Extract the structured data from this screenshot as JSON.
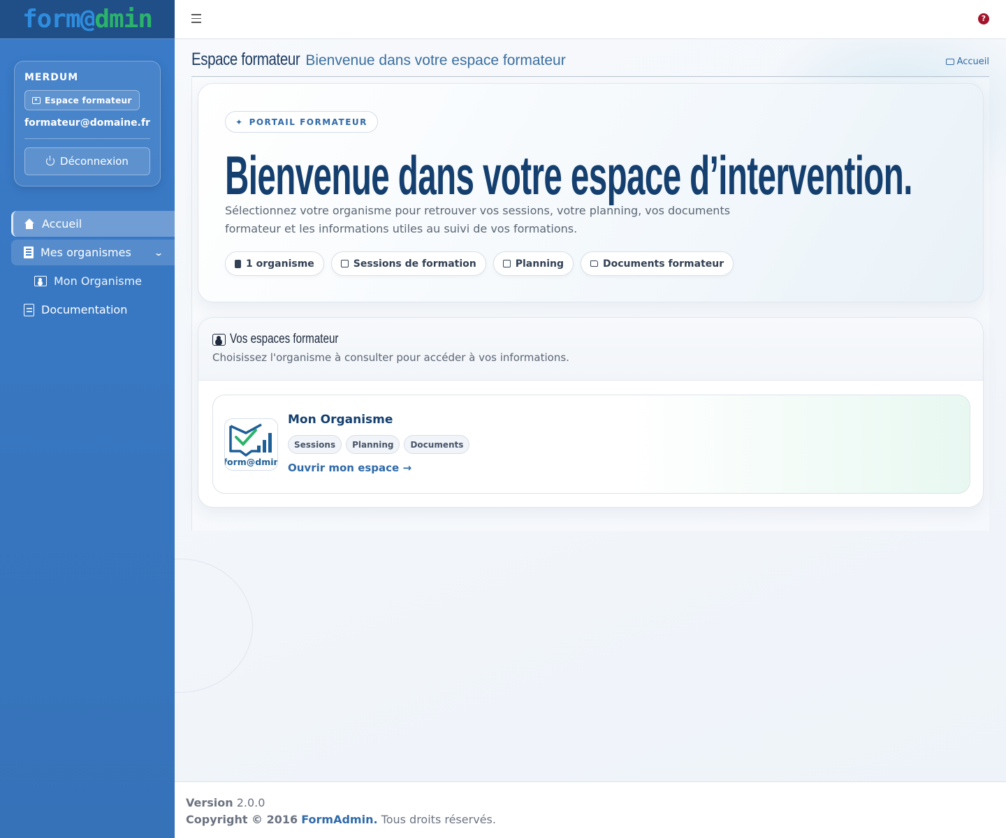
{
  "brand": {
    "part1": "form@",
    "part2": "dmin"
  },
  "user": {
    "name": "MERDUM",
    "role": "Espace formateur",
    "email": "formateur@domaine.fr",
    "logout_label": "Déconnexion"
  },
  "nav": {
    "home": "Accueil",
    "orgs": "Mes organismes",
    "org_sub": "Mon Organisme",
    "docs": "Documentation"
  },
  "header": {
    "title": "Espace formateur",
    "subtitle": "Bienvenue dans votre espace formateur",
    "breadcrumb": "Accueil",
    "help_glyph": "?"
  },
  "hero": {
    "pill": "PORTAIL FORMATEUR",
    "title": "Bienvenue dans votre espace d’intervention.",
    "text": "Sélectionnez votre organisme pour retrouver vos sessions, votre planning, vos documents formateur et les informations utiles au suivi de vos formations.",
    "chips": [
      "1 organisme",
      "Sessions de formation",
      "Planning",
      "Documents formateur"
    ]
  },
  "panel": {
    "title": "Vos espaces formateur",
    "subtitle": "Choisissez l'organisme à consulter pour accéder à vos informations."
  },
  "org": {
    "name": "Mon Organisme",
    "logo_text": "form@dmin",
    "tags": [
      "Sessions",
      "Planning",
      "Documents"
    ],
    "link": "Ouvrir mon espace →"
  },
  "footer": {
    "version_label": "Version",
    "version": "2.0.0",
    "copyright": "Copyright © 2016",
    "company": "FormAdmin.",
    "rights": "Tous droits réservés."
  },
  "colors": {
    "sidebar": "#3a7bc8",
    "brand_bar": "#1f4f86",
    "accent": "#2f6aa8",
    "title": "#143f6e",
    "help": "#a3132b"
  }
}
